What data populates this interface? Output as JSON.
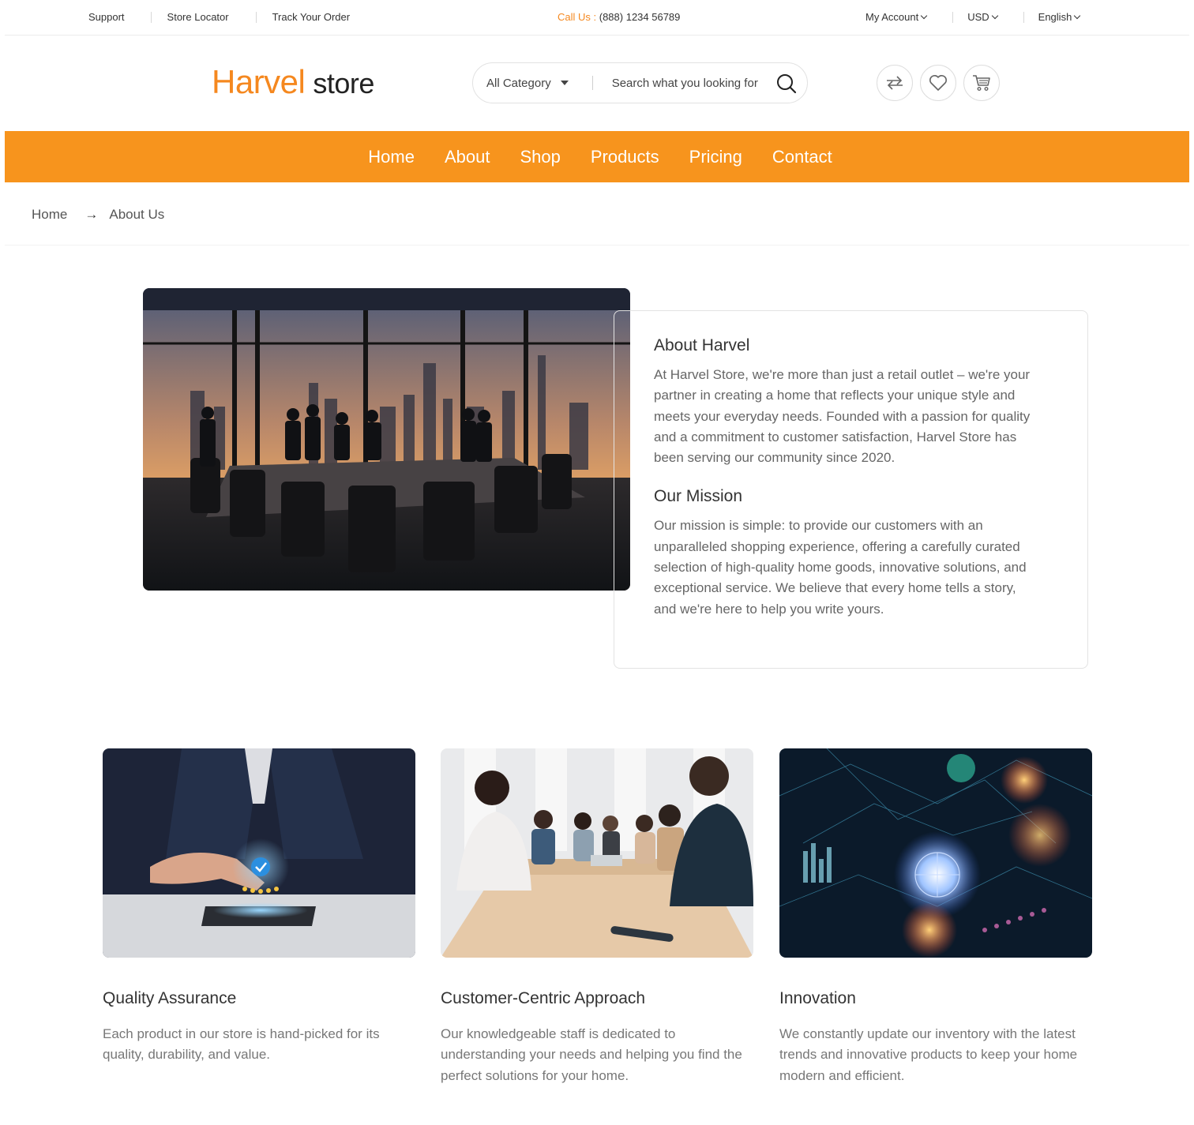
{
  "topbar": {
    "links": [
      "Support",
      "Store Locator",
      "Track Your Order"
    ],
    "call_label": "Call Us :",
    "call_number": "(888) 1234 56789",
    "account": "My Account",
    "currency": "USD",
    "language": "English"
  },
  "logo": {
    "part1": "Harvel",
    "part2": "store"
  },
  "search": {
    "category": "All Category",
    "placeholder": "Search what you looking for"
  },
  "icons": [
    "compare-icon",
    "heart-icon",
    "cart-icon",
    "search-icon"
  ],
  "nav": [
    "Home",
    "About",
    "Shop",
    "Products",
    "Pricing",
    "Contact"
  ],
  "breadcrumb": {
    "home": "Home",
    "arrow": "→",
    "current": "About Us"
  },
  "about": {
    "title": "About Harvel",
    "text": "At Harvel Store, we're more than just a retail outlet – we're your partner in creating a home that reflects your unique style and meets your everyday needs. Founded with a passion for quality and a commitment to customer satisfaction, Harvel Store has been serving our community since 2020.",
    "mission_title": "Our Mission",
    "mission_text": "Our mission is simple: to provide our customers with an unparalleled shopping experience, offering a carefully curated selection of high-quality home goods, innovative solutions, and exceptional service. We believe that every home tells a story, and we're here to help you write yours."
  },
  "features": [
    {
      "title": "Quality Assurance",
      "text": "Each product in our store is hand-picked for its quality, durability, and value."
    },
    {
      "title": "Customer-Centric Approach",
      "text": "Our knowledgeable staff is dedicated to understanding your needs and helping you find the perfect solutions for your home."
    },
    {
      "title": "Innovation",
      "text": "We constantly update our inventory with the latest trends and innovative products to keep your home modern and efficient."
    }
  ],
  "colors": {
    "accent": "#f7941d",
    "logo": "#f5881f"
  }
}
